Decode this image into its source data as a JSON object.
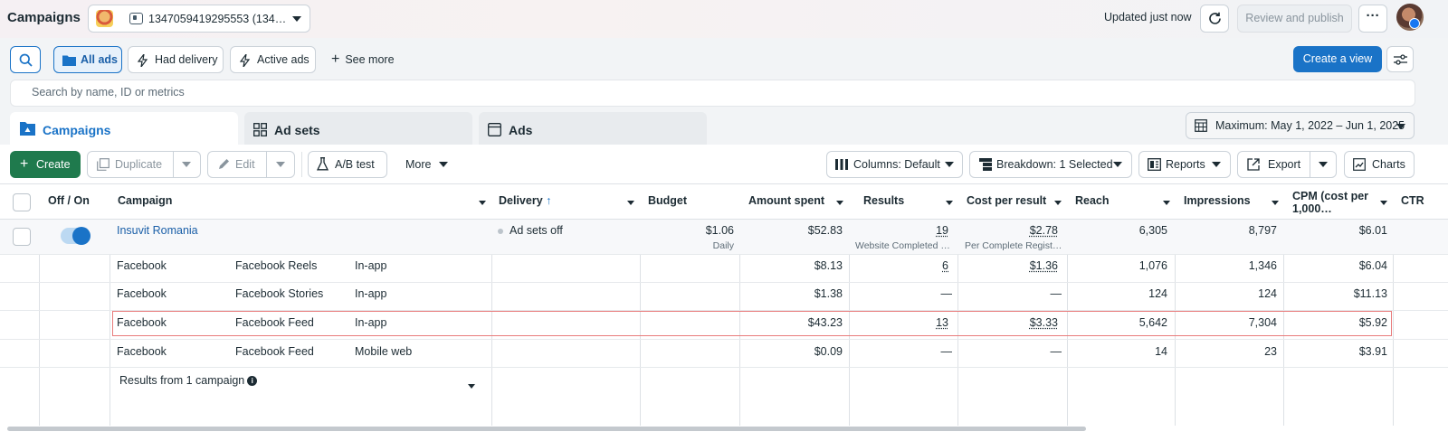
{
  "header": {
    "title": "Campaigns",
    "account": "1347059419295553 (134…",
    "updated": "Updated just now",
    "review_publish": "Review and publish",
    "more": "···"
  },
  "filters": {
    "all_ads": "All ads",
    "had_delivery": "Had delivery",
    "active_ads": "Active ads",
    "see_more": "See more",
    "create_view": "Create a view"
  },
  "search": {
    "placeholder": "Search by name, ID or metrics"
  },
  "tabs": {
    "campaigns": "Campaigns",
    "ad_sets": "Ad sets",
    "ads": "Ads"
  },
  "date_range": "Maximum: May 1, 2022 – Jun 1, 2025",
  "toolbar": {
    "create": "Create",
    "duplicate": "Duplicate",
    "edit": "Edit",
    "ab_test": "A/B test",
    "more": "More",
    "columns": "Columns: Default",
    "breakdown": "Breakdown: 1 Selected",
    "reports": "Reports",
    "export": "Export",
    "charts": "Charts"
  },
  "columns": {
    "off_on": "Off / On",
    "campaign": "Campaign",
    "delivery": "Delivery",
    "budget": "Budget",
    "amount_spent": "Amount spent",
    "results": "Results",
    "cost_per_result": "Cost per result",
    "reach": "Reach",
    "impressions": "Impressions",
    "cpm": "CPM (cost per 1,000…",
    "ctr": "CTR"
  },
  "campaign_row": {
    "name": "Insuvit Romania",
    "delivery": "Ad sets off",
    "budget": "$1.06",
    "budget_sub": "Daily",
    "amount_spent": "$52.83",
    "results": "19",
    "results_sub": "Website Completed …",
    "cost_per_result": "$2.78",
    "cost_per_result_sub": "Per Complete Regist…",
    "reach": "6,305",
    "impressions": "8,797",
    "cpm": "$6.01"
  },
  "breakdown_rows": [
    {
      "platform": "Facebook",
      "placement": "Facebook Reels",
      "device": "In-app",
      "amount_spent": "$8.13",
      "results": "6",
      "cost_per_result": "$1.36",
      "reach": "1,076",
      "impressions": "1,346",
      "cpm": "$6.04"
    },
    {
      "platform": "Facebook",
      "placement": "Facebook Stories",
      "device": "In-app",
      "amount_spent": "$1.38",
      "results": "—",
      "cost_per_result": "—",
      "reach": "124",
      "impressions": "124",
      "cpm": "$11.13"
    },
    {
      "platform": "Facebook",
      "placement": "Facebook Feed",
      "device": "In-app",
      "amount_spent": "$43.23",
      "results": "13",
      "cost_per_result": "$3.33",
      "reach": "5,642",
      "impressions": "7,304",
      "cpm": "$5.92"
    },
    {
      "platform": "Facebook",
      "placement": "Facebook Feed",
      "device": "Mobile web",
      "amount_spent": "$0.09",
      "results": "—",
      "cost_per_result": "—",
      "reach": "14",
      "impressions": "23",
      "cpm": "$3.91"
    }
  ],
  "summary": "Results from 1 campaign"
}
